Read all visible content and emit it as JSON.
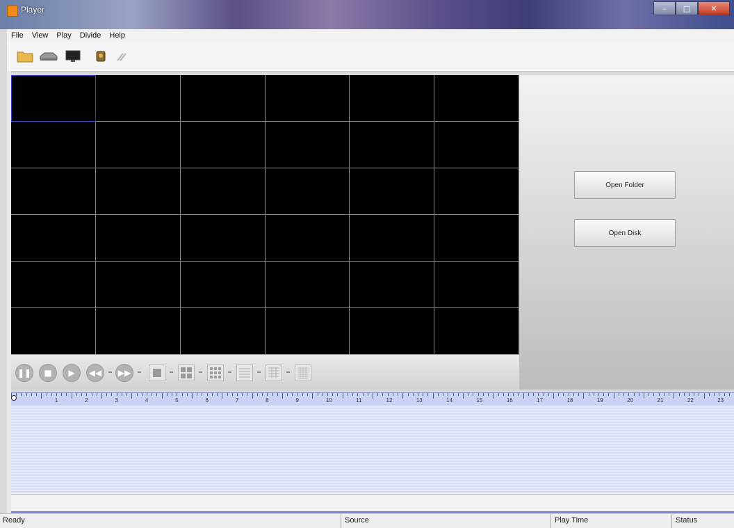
{
  "window": {
    "title": "Player",
    "min_glyph": "–",
    "max_glyph": "□",
    "close_glyph": "✕"
  },
  "menu": [
    "File",
    "View",
    "Play",
    "Divide",
    "Help"
  ],
  "toolbar_icons": [
    "folder-icon",
    "disk-drive-icon",
    "monitor-icon",
    "camera-icon",
    "tools-icon"
  ],
  "panel": {
    "open_folder": "Open Folder",
    "open_disk": "Open Disk"
  },
  "controls": {
    "icons": [
      "pause-icon",
      "stop-icon",
      "play-icon",
      "rewind-icon",
      "fast-forward-icon"
    ],
    "glyphs": [
      "❚❚",
      "■",
      "▶",
      "◀◀",
      "▶▶"
    ],
    "layouts": [
      "layout-1x1-icon",
      "layout-2x2-icon",
      "layout-3x3-icon",
      "layout-4x4-icon",
      "layout-5x5-icon",
      "layout-6x6-icon"
    ]
  },
  "timeline": {
    "hours": [
      "0",
      "1",
      "2",
      "3",
      "4",
      "5",
      "6",
      "7",
      "8",
      "9",
      "10",
      "11",
      "12",
      "13",
      "14",
      "15",
      "16",
      "17",
      "18",
      "19",
      "20",
      "21",
      "22",
      "23"
    ]
  },
  "status": {
    "ready": "Ready",
    "source": "Source",
    "play_time": "Play Time",
    "status": "Status"
  },
  "colors": {
    "accent": "#3c3cc8",
    "timeline": "#c9d4f5"
  }
}
